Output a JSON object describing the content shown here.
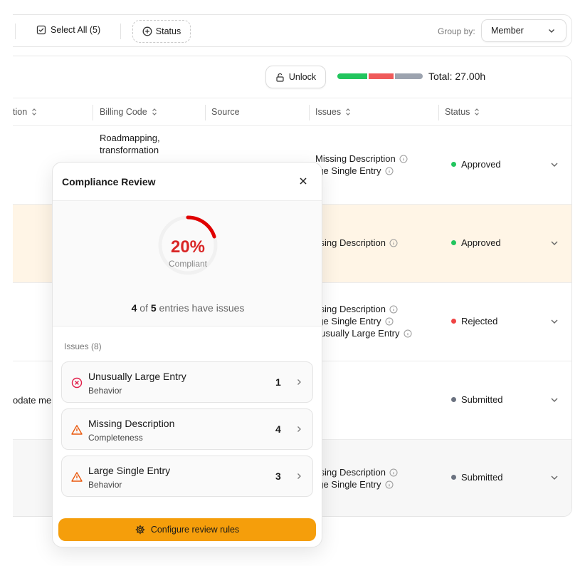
{
  "toolbar": {
    "select_all_label": "Select All (5)",
    "status_filter_label": "Status",
    "group_by_label": "Group by:",
    "group_by_value": "Member"
  },
  "summary": {
    "unlock_label": "Unlock",
    "total_label": "Total: 27.00h",
    "progress_segments": [
      {
        "fraction": 0.36,
        "color": "#22c55e"
      },
      {
        "fraction": 0.31,
        "color": "#ef5a5a"
      },
      {
        "fraction": 0.33,
        "color": "#9ca3af"
      }
    ]
  },
  "table": {
    "columns": [
      "tion",
      "Billing Code",
      "Source",
      "Issues",
      "Status"
    ],
    "rows": [
      {
        "left": "",
        "billing": [
          "Roadmapping,",
          "transformation"
        ],
        "issues": [
          "Missing Description",
          "rge Single Entry"
        ],
        "status": "Approved",
        "status_color": "#22c55e"
      },
      {
        "left": "",
        "billing": [],
        "issues": [
          "ssing Description"
        ],
        "status": "Approved",
        "status_color": "#22c55e"
      },
      {
        "left": "",
        "billing": [],
        "issues": [
          "ssing Description",
          "rge Single Entry",
          "nusually Large Entry"
        ],
        "status": "Rejected",
        "status_color": "#ef4444"
      },
      {
        "left": "odate me",
        "billing": [],
        "issues": [],
        "status": "Submitted",
        "status_color": "#6b7280"
      },
      {
        "left": "",
        "billing": [],
        "issues": [
          "ssing Description",
          "rge Single Entry"
        ],
        "status": "Submitted",
        "status_color": "#6b7280"
      }
    ]
  },
  "review": {
    "title": "Compliance Review",
    "percent": "20%",
    "percent_value": 0.2,
    "percent_label": "Compliant",
    "entries_with_issues": "4",
    "entries_total": "5",
    "entries_of": "of",
    "entries_text": "entries have issues",
    "issues_label": "Issues (8)",
    "issues": [
      {
        "title": "Unusually Large Entry",
        "category": "Behavior",
        "count": "1",
        "severity": "error"
      },
      {
        "title": "Missing Description",
        "category": "Completeness",
        "count": "4",
        "severity": "warning"
      },
      {
        "title": "Large Single Entry",
        "category": "Behavior",
        "count": "3",
        "severity": "warning"
      }
    ],
    "configure_label": "Configure review rules"
  },
  "colors": {
    "accent": "#f59e0b",
    "danger": "#d92626",
    "warning": "#ea580c"
  }
}
